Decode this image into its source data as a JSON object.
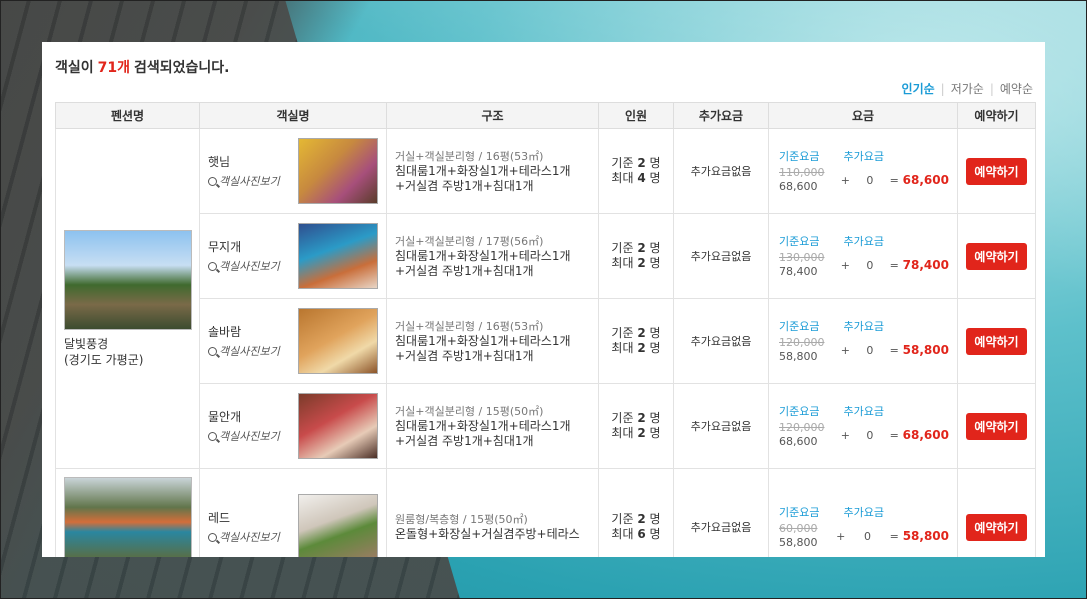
{
  "header": {
    "prefix": "객실이",
    "count": "71개",
    "suffix": "검색되었습니다."
  },
  "sort": [
    {
      "label": "인기순",
      "active": true
    },
    {
      "label": "저가순",
      "active": false
    },
    {
      "label": "예약순",
      "active": false
    }
  ],
  "columns": [
    "펜션명",
    "객실명",
    "구조",
    "인원",
    "추가요금",
    "요금",
    "예약하기"
  ],
  "pensions": [
    {
      "name": "달빛풍경",
      "region": "(경기도 가평군)"
    }
  ],
  "labels": {
    "photo_link": "객실사진보기",
    "base_fee": "기준요금",
    "extra_fee": "추가요금",
    "no_extra": "추가요금없음",
    "book": "예약하기",
    "min": "기준",
    "max": "최대",
    "unit": "명",
    "plus": "+",
    "equals": "="
  },
  "rooms": [
    {
      "name": "햇님",
      "type": "거실+객실분리형 / 16평(53㎡)",
      "desc": "침대룸1개+화장실1개+테라스1개+거실겸 주방1개+침대1개",
      "min": "2",
      "max": "4",
      "original": "110,000",
      "sale": "68,600",
      "extra": "0",
      "total": "68,600"
    },
    {
      "name": "무지개",
      "type": "거실+객실분리형 / 17평(56㎡)",
      "desc": "침대룸1개+화장실1개+테라스1개+거실겸 주방1개+침대1개",
      "min": "2",
      "max": "2",
      "original": "130,000",
      "sale": "78,400",
      "extra": "0",
      "total": "78,400"
    },
    {
      "name": "솔바람",
      "type": "거실+객실분리형 / 16평(53㎡)",
      "desc": "침대룸1개+화장실1개+테라스1개+거실겸 주방1개+침대1개",
      "min": "2",
      "max": "2",
      "original": "120,000",
      "sale": "58,800",
      "extra": "0",
      "total": "58,800"
    },
    {
      "name": "물안개",
      "type": "거실+객실분리형 / 15평(50㎡)",
      "desc": "침대룸1개+화장실1개+테라스1개+거실겸 주방1개+침대1개",
      "min": "2",
      "max": "2",
      "original": "120,000",
      "sale": "68,600",
      "extra": "0",
      "total": "68,600"
    },
    {
      "name": "레드",
      "type": "원룸형/복층형 / 15평(50㎡)",
      "desc": "온돌형+화장실+거실겸주방+테라스",
      "min": "2",
      "max": "6",
      "original": "60,000",
      "sale": "58,800",
      "extra": "0",
      "total": "58,800"
    }
  ]
}
